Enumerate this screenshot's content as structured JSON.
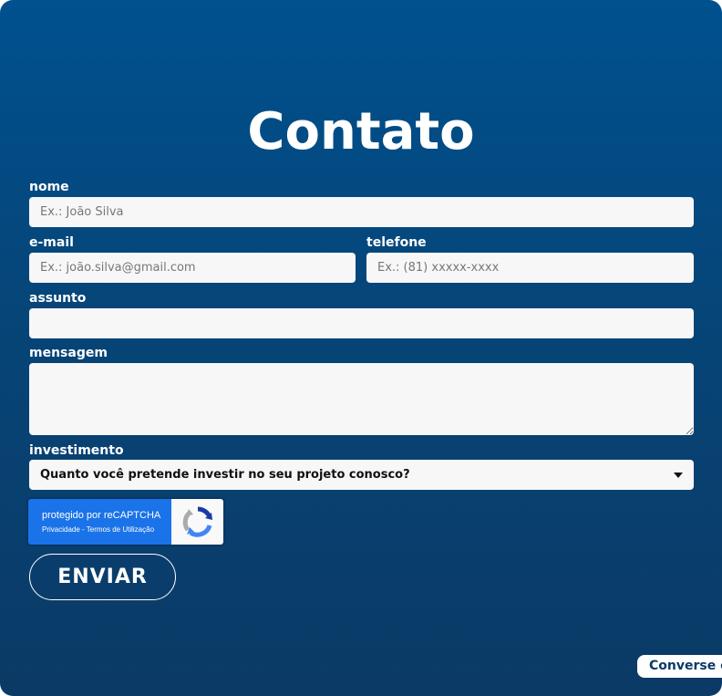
{
  "form": {
    "title": "Contato",
    "name": {
      "label": "nome",
      "placeholder": "Ex.: João Silva"
    },
    "email": {
      "label": "e-mail",
      "placeholder": "Ex.: joão.silva@gmail.com"
    },
    "phone": {
      "label": "telefone",
      "placeholder": "Ex.: (81) xxxxx-xxxx"
    },
    "subject": {
      "label": "assunto",
      "placeholder": ""
    },
    "message": {
      "label": "mensagem",
      "placeholder": ""
    },
    "investment": {
      "label": "investimento",
      "selected": "Quanto você pretende investir no seu projeto conosco?"
    },
    "recaptcha": {
      "main_text": "protegido por reCAPTCHA",
      "links_text": "Privacidade - Termos de Utilização"
    },
    "submit_label": "ENVIAR"
  },
  "chat": {
    "label": "Converse c"
  },
  "colors": {
    "background_top": "#00518f",
    "background_bottom": "#0b3a66",
    "field": "#f7f7f7",
    "recaptcha_blue": "#1a73e8"
  },
  "icons": {
    "recaptcha": "recaptcha-logo-icon",
    "dropdown": "chevron-down-icon",
    "resize": "resize-handle-icon"
  }
}
